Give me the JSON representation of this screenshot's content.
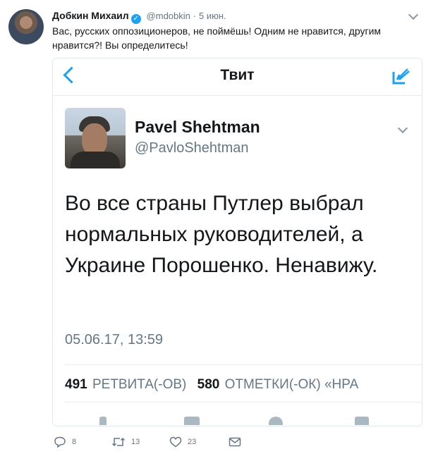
{
  "tweet": {
    "author_name": "Добкин Михаил",
    "author_handle": "@mdobkin",
    "separator": "·",
    "date": "5 июн.",
    "text": "Вас, русских оппозиционеров, не поймёшь! Одним не нравится, другим нравится?! Вы определитесь!",
    "verified_icon": "verified-check-icon"
  },
  "quoted_screenshot": {
    "header_title": "Твит",
    "author_name": "Pavel Shehtman",
    "author_handle": "@PavloShehtman",
    "text": "Во все страны Путлер выбрал нормальных руководителей, а Украине Порошенко. Ненавижу.",
    "timestamp": "05.06.17, 13:59",
    "retweets_count": "491",
    "retweets_label": "РЕТВИТА(-ОВ)",
    "likes_count": "580",
    "likes_label": "ОТМЕТКИ(-ОК) «НРА"
  },
  "actions": {
    "replies": "8",
    "retweets": "13",
    "likes": "23"
  },
  "colors": {
    "accent": "#1da1f2",
    "secondary_text": "#657786",
    "border": "#e1e8ed"
  }
}
